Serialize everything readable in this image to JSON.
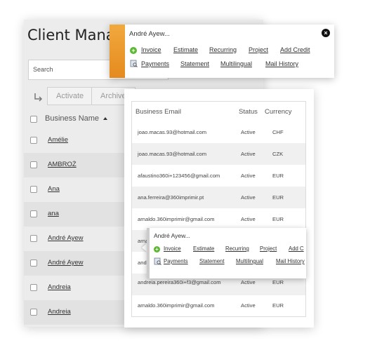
{
  "page": {
    "title": "Client Manage"
  },
  "search": {
    "placeholder": "Search"
  },
  "toolbar": {
    "activate_label": "Activate",
    "archive_label": "Archive"
  },
  "clients": {
    "header": {
      "business_name": "Business Name"
    },
    "rows": [
      "Amélie",
      "AMBROŻ",
      "Ana",
      "ana",
      "André Ayew",
      "André Ayew",
      "Andreia",
      "Andreia"
    ]
  },
  "emails": {
    "headers": {
      "email": "Business Email",
      "status": "Status",
      "currency": "Currency"
    },
    "rows": [
      {
        "email": "joao.macas.93@hotmail.com",
        "status": "Active",
        "currency": "CHF"
      },
      {
        "email": "joao.macas.93@hotmail.com",
        "status": "Active",
        "currency": "CZK"
      },
      {
        "email": "afaustino360i+123456@gmail.com",
        "status": "Active",
        "currency": "EUR"
      },
      {
        "email": "ana.ferreira@360imprimir.pt",
        "status": "Active",
        "currency": "EUR"
      },
      {
        "email": "arnaldo.360imprimir@gmail.com",
        "status": "Active",
        "currency": "EUR"
      },
      {
        "email": "arna",
        "status": "",
        "currency": ""
      },
      {
        "email": "andr",
        "status": "",
        "currency": ""
      },
      {
        "email": "andreia.pereira360i+f3@gmail.com",
        "status": "Active",
        "currency": "EUR"
      },
      {
        "email": "arnaldo.360imprimir@gmail.com",
        "status": "Active",
        "currency": "EUR"
      }
    ]
  },
  "popup_main": {
    "name": "André Ayew...",
    "actions_row1": [
      "Invoice",
      "Estimate",
      "Recurring",
      "Project",
      "Add Credit"
    ],
    "actions_row2": [
      "Payments",
      "Statement",
      "Multilingual",
      "Mail History"
    ]
  },
  "popup_small": {
    "name": "André Ayew...",
    "actions_row1": [
      "Invoice",
      "Estimate",
      "Recurring",
      "Project",
      "Add C"
    ],
    "actions_row2": [
      "Payments",
      "Statement",
      "Multilingual",
      "Mail History"
    ]
  },
  "colors": {
    "accent_orange": "#e8931f",
    "plus_green": "#5cb833"
  }
}
